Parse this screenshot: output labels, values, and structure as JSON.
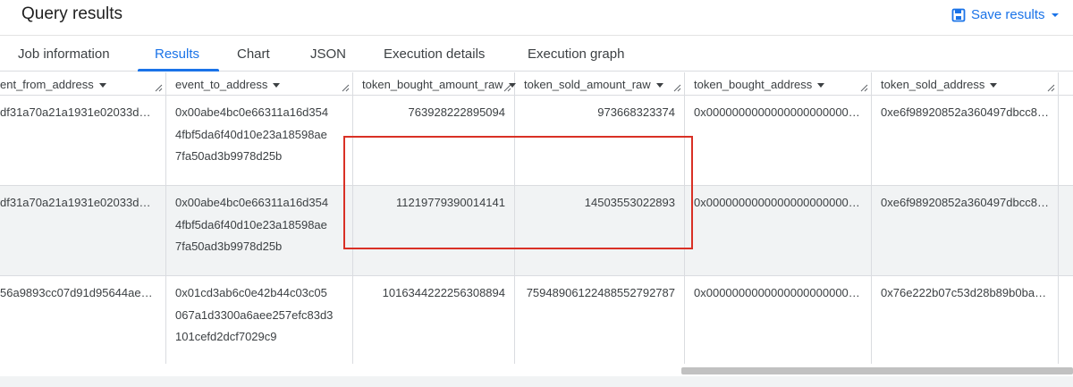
{
  "header": {
    "title": "Query results",
    "save_label": "Save results"
  },
  "tabs": [
    {
      "label": "Job information"
    },
    {
      "label": "Results"
    },
    {
      "label": "Chart"
    },
    {
      "label": "JSON"
    },
    {
      "label": "Execution details"
    },
    {
      "label": "Execution graph"
    }
  ],
  "active_tab": "Results",
  "columns": [
    "ent_from_address",
    "event_to_address",
    "token_bought_amount_raw",
    "token_sold_amount_raw",
    "token_bought_address",
    "token_sold_address"
  ],
  "rows": [
    {
      "from": "df31a70a21a1931e02033dbb...",
      "to_lines": [
        "0x00abe4bc0e66311a16d354",
        "4fbf5da6f40d10e23a18598ae",
        "7fa50ad3b9978d25b"
      ],
      "bought_raw": "763928222895094",
      "sold_raw": "973668323374",
      "bought_address": "0x000000000000000000000000...",
      "sold_address": "0xe6f98920852a360497dbcc8e..."
    },
    {
      "from": "df31a70a21a1931e02033dbb...",
      "to_lines": [
        "0x00abe4bc0e66311a16d354",
        "4fbf5da6f40d10e23a18598ae",
        "7fa50ad3b9978d25b"
      ],
      "bought_raw": "11219779390014141",
      "sold_raw": "14503553022893",
      "bought_address": "0x000000000000000000000000...",
      "sold_address": "0xe6f98920852a360497dbcc8e..."
    },
    {
      "from": "56a9893cc07d91d95644aed...",
      "to_lines": [
        "0x01cd3ab6c0e42b44c03c05",
        "067a1d3300a6aee257efc83d3",
        "101cefd2dcf7029c9"
      ],
      "bought_raw": "1016344222256308894",
      "sold_raw": "7594890612248855279278​7",
      "bought_address": "0x000000000000000000000000...",
      "sold_address": "0x76e222b07c53d28b89b0bac..."
    }
  ],
  "colors": {
    "accent": "#1a73e8",
    "highlight": "#d93025",
    "row_shade": "#f1f3f4"
  }
}
